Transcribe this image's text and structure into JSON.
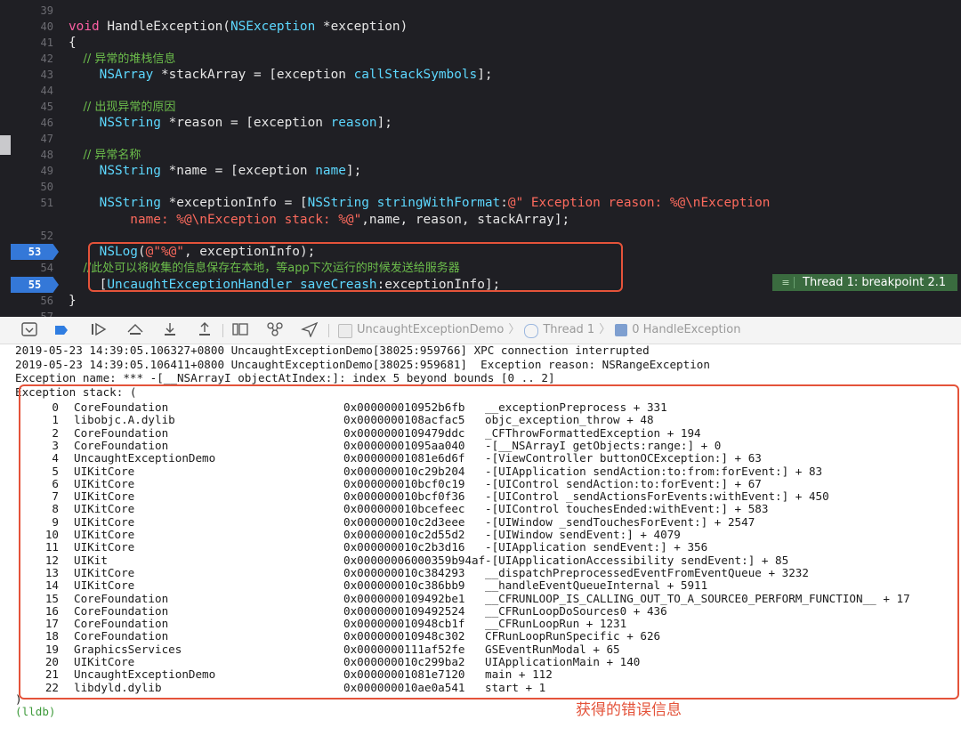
{
  "editor": {
    "lines": [
      {
        "no": "39",
        "tokens": []
      },
      {
        "no": "40",
        "tokens": [
          [
            "kw",
            "void"
          ],
          [
            "pl",
            " HandleException("
          ],
          [
            "ty",
            "NSException"
          ],
          [
            "pl",
            " *exception)"
          ]
        ]
      },
      {
        "no": "41",
        "tokens": [
          [
            "pl",
            "{"
          ]
        ]
      },
      {
        "no": "42",
        "tokens": [
          [
            "cm",
            "    // 异常的堆栈信息"
          ]
        ]
      },
      {
        "no": "43",
        "tokens": [
          [
            "pl",
            "    "
          ],
          [
            "ty",
            "NSArray"
          ],
          [
            "pl",
            " *stackArray = [exception "
          ],
          [
            "ty",
            "callStackSymbols"
          ],
          [
            "pl",
            "];"
          ]
        ]
      },
      {
        "no": "44",
        "tokens": []
      },
      {
        "no": "45",
        "tokens": [
          [
            "cm",
            "    // 出现异常的原因"
          ]
        ]
      },
      {
        "no": "46",
        "tokens": [
          [
            "pl",
            "    "
          ],
          [
            "ty",
            "NSString"
          ],
          [
            "pl",
            " *reason = [exception "
          ],
          [
            "ty",
            "reason"
          ],
          [
            "pl",
            "];"
          ]
        ]
      },
      {
        "no": "47",
        "tokens": []
      },
      {
        "no": "48",
        "tokens": [
          [
            "cm",
            "    // 异常名称"
          ]
        ]
      },
      {
        "no": "49",
        "tokens": [
          [
            "pl",
            "    "
          ],
          [
            "ty",
            "NSString"
          ],
          [
            "pl",
            " *name = [exception "
          ],
          [
            "ty",
            "name"
          ],
          [
            "pl",
            "];"
          ]
        ]
      },
      {
        "no": "50",
        "tokens": []
      },
      {
        "no": "51",
        "tokens": [
          [
            "pl",
            "    "
          ],
          [
            "ty",
            "NSString"
          ],
          [
            "pl",
            " *exceptionInfo = ["
          ],
          [
            "ty",
            "NSString"
          ],
          [
            "pl",
            " "
          ],
          [
            "ty",
            "stringWithFormat"
          ],
          [
            "pl",
            ":"
          ],
          [
            "st",
            "@\" Exception reason: %@\\nException"
          ]
        ]
      },
      {
        "no": "",
        "tokens": [
          [
            "st",
            "        name: %@\\nException stack: %@\""
          ],
          [
            "pl",
            ",name, reason, stackArray];"
          ]
        ]
      },
      {
        "no": "52",
        "tokens": []
      },
      {
        "no": "53",
        "tokens": [
          [
            "pl",
            "    "
          ],
          [
            "ty",
            "NSLog"
          ],
          [
            "pl",
            "("
          ],
          [
            "st",
            "@\"%@\""
          ],
          [
            "pl",
            ", exceptionInfo);"
          ]
        ]
      },
      {
        "no": "54",
        "tokens": [
          [
            "cm",
            "    //此处可以将收集的信息保存在本地，等app下次运行的时候发送给服务器"
          ]
        ]
      },
      {
        "no": "55",
        "tokens": [
          [
            "pl",
            "    ["
          ],
          [
            "ty",
            "UncaughtExceptionHandler"
          ],
          [
            "pl",
            " "
          ],
          [
            "ty",
            "saveCreash"
          ],
          [
            "pl",
            ":exceptionInfo];"
          ]
        ]
      },
      {
        "no": "56",
        "tokens": [
          [
            "pl",
            "}"
          ]
        ]
      },
      {
        "no": "57",
        "tokens": []
      }
    ],
    "breakpoint_label": "Thread 1: breakpoint 2.1",
    "breakpoint_badge_icon": "≡"
  },
  "debugbar": {
    "breadcrumb": {
      "app": "UncaughtExceptionDemo",
      "thread": "Thread 1",
      "frame": "0 HandleException"
    }
  },
  "console": {
    "log_lines": [
      "2019-05-23 14:39:05.106327+0800 UncaughtExceptionDemo[38025:959766] XPC connection interrupted",
      "2019-05-23 14:39:05.106411+0800 UncaughtExceptionDemo[38025:959681]  Exception reason: NSRangeException",
      "Exception name: *** -[__NSArrayI objectAtIndex:]: index 5 beyond bounds [0 .. 2]",
      "Exception stack: ("
    ],
    "frames": [
      {
        "i": "0",
        "lib": "CoreFoundation",
        "addr": "0x000000010952b6fb",
        "sym": "__exceptionPreprocess + 331"
      },
      {
        "i": "1",
        "lib": "libobjc.A.dylib",
        "addr": "0x0000000108acfac5",
        "sym": "objc_exception_throw + 48"
      },
      {
        "i": "2",
        "lib": "CoreFoundation",
        "addr": "0x0000000109479ddc",
        "sym": "_CFThrowFormattedException + 194"
      },
      {
        "i": "3",
        "lib": "CoreFoundation",
        "addr": "0x00000001095aa040",
        "sym": "-[__NSArrayI getObjects:range:] + 0"
      },
      {
        "i": "4",
        "lib": "UncaughtExceptionDemo",
        "addr": "0x00000001081e6d6f",
        "sym": "-[ViewController buttonOCException:] + 63"
      },
      {
        "i": "5",
        "lib": "UIKitCore",
        "addr": "0x000000010c29b204",
        "sym": "-[UIApplication sendAction:to:from:forEvent:] + 83"
      },
      {
        "i": "6",
        "lib": "UIKitCore",
        "addr": "0x000000010bcf0c19",
        "sym": "-[UIControl sendAction:to:forEvent:] + 67"
      },
      {
        "i": "7",
        "lib": "UIKitCore",
        "addr": "0x000000010bcf0f36",
        "sym": "-[UIControl _sendActionsForEvents:withEvent:] + 450"
      },
      {
        "i": "8",
        "lib": "UIKitCore",
        "addr": "0x000000010bcefeec",
        "sym": "-[UIControl touchesEnded:withEvent:] + 583"
      },
      {
        "i": "9",
        "lib": "UIKitCore",
        "addr": "0x000000010c2d3eee",
        "sym": "-[UIWindow _sendTouchesForEvent:] + 2547"
      },
      {
        "i": "10",
        "lib": "UIKitCore",
        "addr": "0x000000010c2d55d2",
        "sym": "-[UIWindow sendEvent:] + 4079"
      },
      {
        "i": "11",
        "lib": "UIKitCore",
        "addr": "0x000000010c2b3d16",
        "sym": "-[UIApplication sendEvent:] + 356"
      },
      {
        "i": "12",
        "lib": "UIKit",
        "addr": "0x00000006000359b94af",
        "sym": "-[UIApplicationAccessibility sendEvent:] + 85"
      },
      {
        "i": "13",
        "lib": "UIKitCore",
        "addr": "0x000000010c384293",
        "sym": "__dispatchPreprocessedEventFromEventQueue + 3232"
      },
      {
        "i": "14",
        "lib": "UIKitCore",
        "addr": "0x000000010c386bb9",
        "sym": "__handleEventQueueInternal + 5911"
      },
      {
        "i": "15",
        "lib": "CoreFoundation",
        "addr": "0x0000000109492be1",
        "sym": "__CFRUNLOOP_IS_CALLING_OUT_TO_A_SOURCE0_PERFORM_FUNCTION__ + 17"
      },
      {
        "i": "16",
        "lib": "CoreFoundation",
        "addr": "0x0000000109492524",
        "sym": "__CFRunLoopDoSources0 + 436"
      },
      {
        "i": "17",
        "lib": "CoreFoundation",
        "addr": "0x000000010948cb1f",
        "sym": "__CFRunLoopRun + 1231"
      },
      {
        "i": "18",
        "lib": "CoreFoundation",
        "addr": "0x000000010948c302",
        "sym": "CFRunLoopRunSpecific + 626"
      },
      {
        "i": "19",
        "lib": "GraphicsServices",
        "addr": "0x0000000111af52fe",
        "sym": "GSEventRunModal + 65"
      },
      {
        "i": "20",
        "lib": "UIKitCore",
        "addr": "0x000000010c299ba2",
        "sym": "UIApplicationMain + 140"
      },
      {
        "i": "21",
        "lib": "UncaughtExceptionDemo",
        "addr": "0x00000001081e7120",
        "sym": "main + 112"
      },
      {
        "i": "22",
        "lib": "libdyld.dylib",
        "addr": "0x000000010ae0a541",
        "sym": "start + 1"
      }
    ],
    "close_paren": ")",
    "prompt": "(lldb)"
  },
  "annotation": {
    "note": "获得的错误信息"
  },
  "colors": {
    "editor_bg": "#1f1f24",
    "keyword": "#fc5fa3",
    "type": "#5dd8ff",
    "comment": "#6cbe4b",
    "string": "#fc6a5d",
    "breakpoint": "#3478d8",
    "annotation": "#e4533a",
    "lldb_prompt": "#3d9a3a"
  }
}
